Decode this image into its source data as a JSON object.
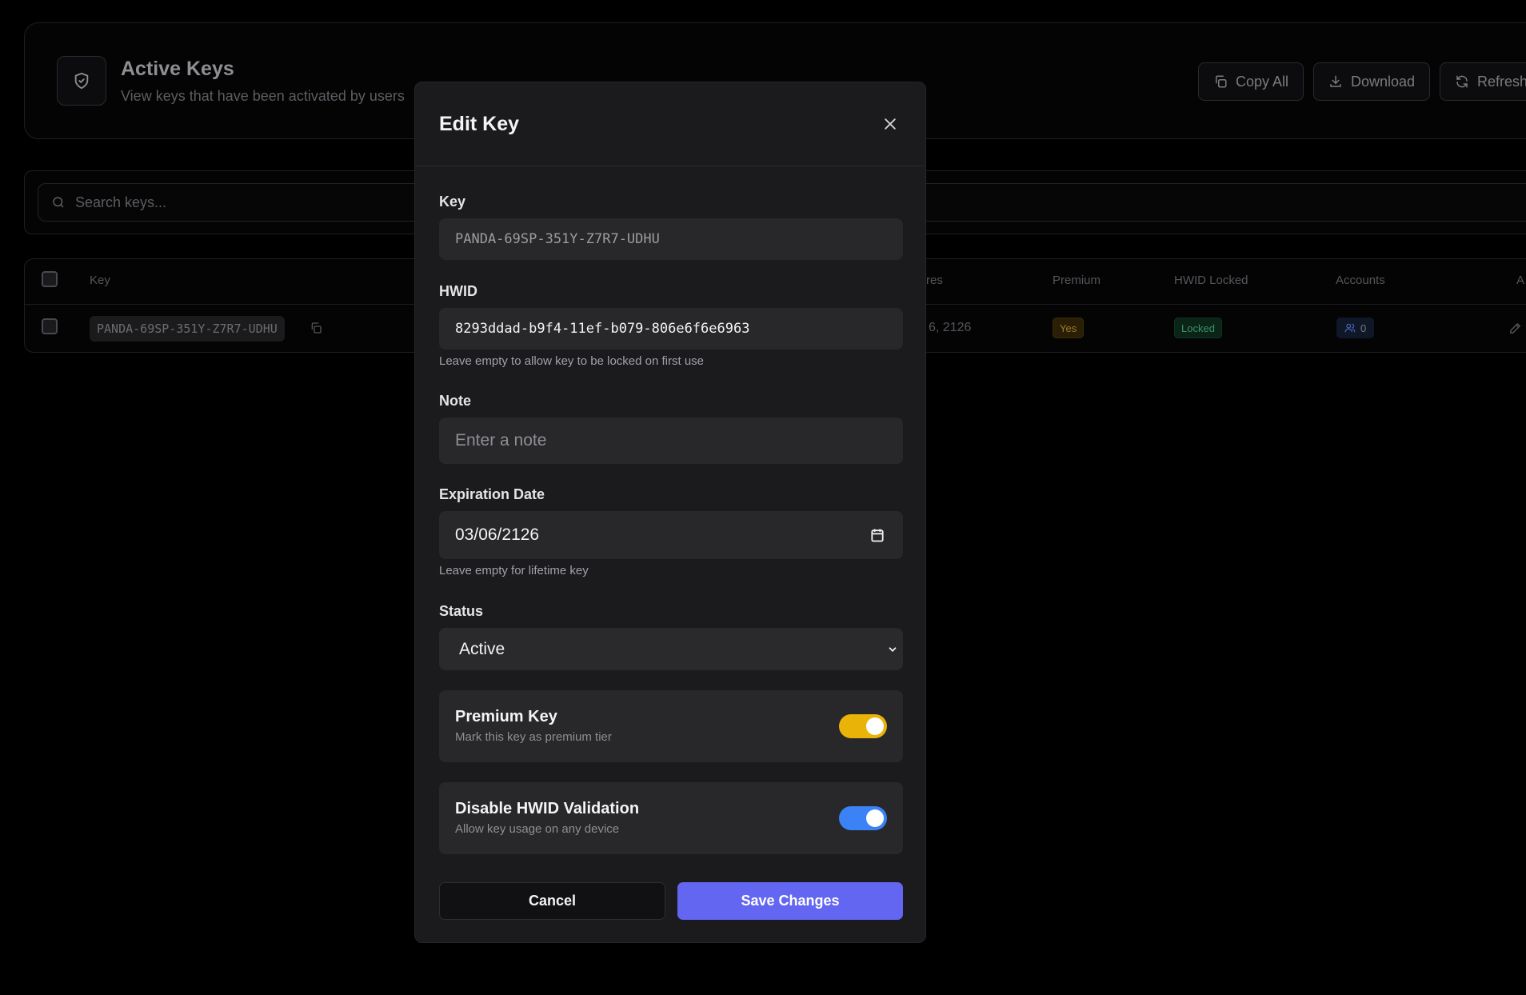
{
  "page": {
    "title": "Active Keys",
    "subtitle": "View keys that have been activated by users",
    "actions": {
      "copy_all": "Copy All",
      "download": "Download",
      "refresh": "Refresh"
    },
    "search_placeholder": "Search keys..."
  },
  "table": {
    "headers": {
      "key": "Key",
      "expires": "res",
      "premium": "Premium",
      "hwid_locked": "HWID Locked",
      "accounts": "Accounts",
      "actions": "A"
    },
    "rows": [
      {
        "key": "PANDA-69SP-351Y-Z7R7-UDHU",
        "expires": "6, 2126",
        "premium": "Yes",
        "hwid_locked": "Locked",
        "accounts": "0"
      }
    ]
  },
  "modal": {
    "title": "Edit Key",
    "key_label": "Key",
    "key_value": "PANDA-69SP-351Y-Z7R7-UDHU",
    "hwid_label": "HWID",
    "hwid_value": "8293ddad-b9f4-11ef-b079-806e6f6e6963",
    "hwid_hint": "Leave empty to allow key to be locked on first use",
    "note_label": "Note",
    "note_placeholder": "Enter a note",
    "expiration_label": "Expiration Date",
    "expiration_value": "03/06/2126",
    "expiration_hint": "Leave empty for lifetime key",
    "status_label": "Status",
    "status_value": "Active",
    "premium_title": "Premium Key",
    "premium_sub": "Mark this key as premium tier",
    "premium_on": true,
    "hwid_disable_title": "Disable HWID Validation",
    "hwid_disable_sub": "Allow key usage on any device",
    "hwid_disable_on": true,
    "cancel_label": "Cancel",
    "save_label": "Save Changes"
  },
  "colors": {
    "accent": "#6366f1",
    "premium_toggle": "#eab308",
    "hwid_toggle": "#3b82f6"
  },
  "icons": [
    "shield-check-icon",
    "copy-icon",
    "download-icon",
    "refresh-icon",
    "search-icon",
    "close-icon",
    "calendar-icon",
    "chevron-down-icon",
    "users-icon",
    "edit-icon"
  ]
}
